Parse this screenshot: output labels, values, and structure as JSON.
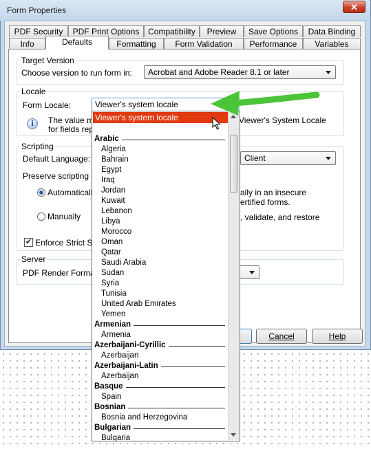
{
  "window": {
    "title": "Form Properties",
    "close_label": "✕"
  },
  "tabs": {
    "row1": [
      "PDF Security",
      "PDF Print Options",
      "Compatibility",
      "Preview",
      "Save Options",
      "Data Binding"
    ],
    "row2": [
      "Info",
      "Defaults",
      "Formatting",
      "Form Validation",
      "Performance",
      "Variables"
    ],
    "selected": "Defaults"
  },
  "target_version": {
    "group_label": "Target Version",
    "prompt": "Choose version to run form in:",
    "value": "Acrobat and Adobe Reader 8.1 or later"
  },
  "locale": {
    "group_label": "Locale",
    "form_locale_label": "Form Locale:",
    "value": "Viewer's system locale",
    "info_left_1": "The value ma",
    "info_left_2": "for fields repi",
    "info_right": "Viewer's System Locale"
  },
  "scripting": {
    "group_label": "Scripting",
    "default_language_label": "Default Language:",
    "default_language_value": "Client",
    "preserve_label": "Preserve scripting ch",
    "auto_label": "Automatically",
    "auto_desc_1": "ally in an insecure",
    "auto_desc_2": "ertified forms.",
    "manual_label": "Manually",
    "manual_desc": ", validate, and restore",
    "enforce_label": "Enforce Strict Sco",
    "enforce_checked": true,
    "auto_selected": true
  },
  "server": {
    "group_label": "Server",
    "render_label": "PDF Render Format:"
  },
  "buttons": {
    "cancel": "Cancel",
    "help": "Help"
  },
  "dropdown": {
    "selected": "Viewer's system locale",
    "groups": [
      {
        "name": "Arabic",
        "items": [
          "Algeria",
          "Bahrain",
          "Egypt",
          "Iraq",
          "Jordan",
          "Kuwait",
          "Lebanon",
          "Libya",
          "Morocco",
          "Oman",
          "Qatar",
          "Saudi Arabia",
          "Sudan",
          "Syria",
          "Tunisia",
          "United Arab Emirates",
          "Yemen"
        ]
      },
      {
        "name": "Armenian",
        "items": [
          "Armenia"
        ]
      },
      {
        "name": "Azerbaijani-Cyrillic",
        "items": [
          "Azerbaijan"
        ]
      },
      {
        "name": "Azerbaijani-Latin",
        "items": [
          "Azerbaijan"
        ]
      },
      {
        "name": "Basque",
        "items": [
          "Spain"
        ]
      },
      {
        "name": "Bosnian",
        "items": [
          "Bosnia and Herzegovina"
        ]
      },
      {
        "name": "Bulgarian",
        "items": [
          "Bulgaria"
        ]
      }
    ]
  },
  "colors": {
    "highlight": "#e23a0f",
    "arrow": "#4cc43a",
    "window_frame": "#c6d8ea"
  },
  "icons": {
    "info": "info-icon",
    "cursor": "mouse-pointer-icon",
    "annotation": "green-arrow-icon"
  }
}
